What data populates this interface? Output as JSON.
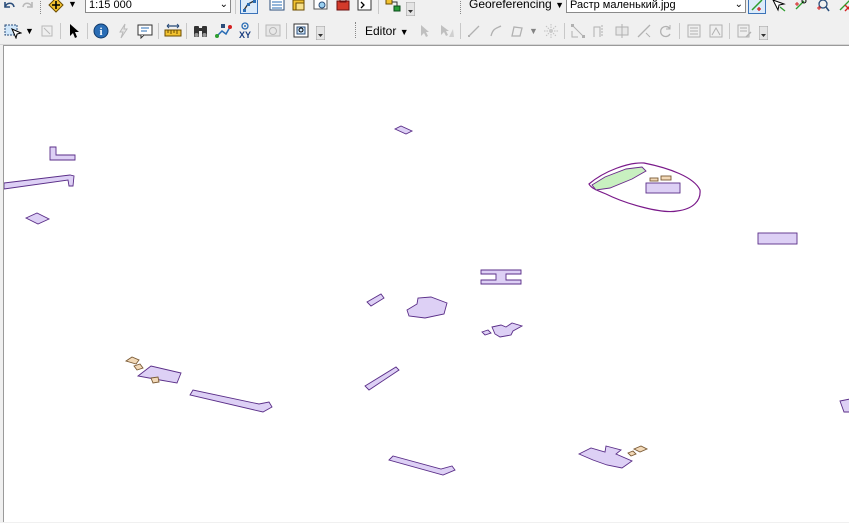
{
  "toolbar1": {
    "scale_value": "1:15 000",
    "georeferencing_label": "Georeferencing",
    "georef_layer_value": "Растр маленький.jpg"
  },
  "toolbar2": {
    "editor_label": "Editor"
  },
  "colors": {
    "map_feature_fill": "#ddd0f5",
    "map_feature_stroke": "#5a2e88",
    "tan_feature_fill": "#f2d9b8",
    "green_feature_fill": "#c8f0c0",
    "georef_add_control_point": "#2e9e2e",
    "georef_delete": "#d42020"
  },
  "icons": [
    "undo-icon",
    "redo-icon",
    "full-extent-icon",
    "select-features-icon",
    "identify-icon",
    "html-popup-icon",
    "measure-icon",
    "find-icon",
    "route-icon",
    "go-to-xy-icon",
    "edit-tool-icon",
    "sketch-icon",
    "vertex-icon",
    "table-icon"
  ]
}
